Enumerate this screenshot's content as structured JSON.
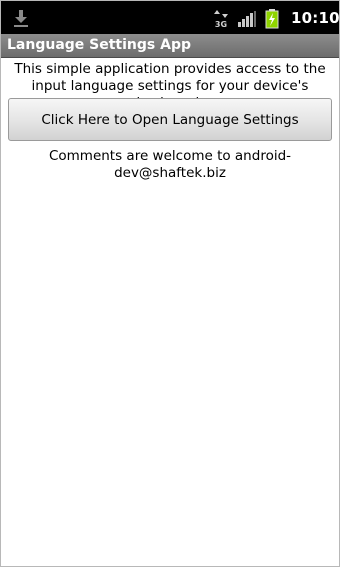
{
  "status_bar": {
    "time": "10:10",
    "network_label": "3G",
    "icons": [
      "download-icon",
      "signal-type-icon",
      "signal-bars-icon",
      "battery-icon"
    ]
  },
  "app": {
    "title": "Language Settings App"
  },
  "main": {
    "intro": "This simple application provides access to the input language settings for your device's keyboard.",
    "open_button_label": "Click Here to Open Language Settings",
    "comments": "Comments are welcome to android-dev@shaftek.biz"
  },
  "colors": {
    "status_bar_bg": "#000000",
    "title_bar_bg": "#7c7c7c",
    "battery_green": "#8fd400"
  }
}
